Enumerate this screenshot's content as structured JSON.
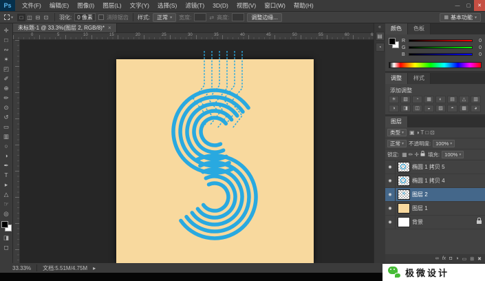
{
  "menu": {
    "logo": "Ps",
    "items": [
      "文件(F)",
      "编辑(E)",
      "图像(I)",
      "图层(L)",
      "文字(Y)",
      "选择(S)",
      "滤镜(T)",
      "3D(D)",
      "视图(V)",
      "窗口(W)",
      "帮助(H)"
    ],
    "minimize": "—",
    "restore": "▢",
    "close": "✕"
  },
  "icons": {
    "caret": "▾",
    "swap": "⇄",
    "eye": "◉",
    "scatter": "≈",
    "workspace_grid": "▦",
    "collapse": "«"
  },
  "options": {
    "selection_modes": [
      {
        "name": "new-selection-icon",
        "glyph": "□"
      },
      {
        "name": "add-selection-icon",
        "glyph": "◫"
      },
      {
        "name": "subtract-selection-icon",
        "glyph": "⊟"
      },
      {
        "name": "intersect-selection-icon",
        "glyph": "⊡"
      }
    ],
    "feather_label": "羽化:",
    "feather_value": "0 像素",
    "antialias": "消除锯齿",
    "style_label": "样式:",
    "style_value": "正常",
    "width_label": "宽度:",
    "height_label": "高度:",
    "refine_edge": "调整边缘...",
    "workspace": "基本功能"
  },
  "tab": {
    "title": "未标题-1 @ 33.3%(图层 2, RGB/8)*",
    "close": "×"
  },
  "ruler": {
    "h_numbers": [
      "0",
      "5",
      "10",
      "15",
      "20",
      "25",
      "30",
      "35",
      "40",
      "45",
      "50",
      "55",
      "60",
      "65"
    ]
  },
  "tools": [
    {
      "name": "move-tool",
      "glyph": "✛"
    },
    {
      "name": "rectangular-marquee-tool",
      "glyph": "□"
    },
    {
      "name": "lasso-tool",
      "glyph": "∾"
    },
    {
      "name": "quick-selection-tool",
      "glyph": "✶"
    },
    {
      "name": "crop-tool",
      "glyph": "◰"
    },
    {
      "name": "eyedropper-tool",
      "glyph": "✐"
    },
    {
      "name": "healing-brush-tool",
      "glyph": "⊕"
    },
    {
      "name": "brush-tool",
      "glyph": "✏"
    },
    {
      "name": "clone-stamp-tool",
      "glyph": "⊙"
    },
    {
      "name": "history-brush-tool",
      "glyph": "↺"
    },
    {
      "name": "eraser-tool",
      "glyph": "▭"
    },
    {
      "name": "gradient-tool",
      "glyph": "▥"
    },
    {
      "name": "blur-tool",
      "glyph": "○"
    },
    {
      "name": "dodge-tool",
      "glyph": "◑"
    },
    {
      "name": "pen-tool",
      "glyph": "✒"
    },
    {
      "name": "type-tool",
      "glyph": "T"
    },
    {
      "name": "path-selection-tool",
      "glyph": "▸"
    },
    {
      "name": "shape-tool",
      "glyph": "△"
    },
    {
      "name": "hand-tool",
      "glyph": "☞"
    },
    {
      "name": "zoom-tool",
      "glyph": "◎"
    }
  ],
  "extra_tools": [
    {
      "name": "quick-mask-mode-button",
      "glyph": "◨"
    },
    {
      "name": "screen-mode-button",
      "glyph": "◻"
    }
  ],
  "dock": {
    "icons": [
      {
        "name": "history-panel-icon",
        "glyph": "▤"
      },
      {
        "name": "properties-panel-icon",
        "glyph": "◔"
      }
    ]
  },
  "color_panel": {
    "tabs": [
      "颜色",
      "色板"
    ],
    "channels": [
      {
        "label": "R",
        "value": "0",
        "hex": "#ff0000"
      },
      {
        "label": "G",
        "value": "0",
        "hex": "#00ff00"
      },
      {
        "label": "B",
        "value": "0",
        "hex": "#0000ff"
      }
    ]
  },
  "adjustments_panel": {
    "tabs": [
      "调整",
      "样式"
    ],
    "title": "添加调整",
    "icons": [
      "☀",
      "▧",
      "◔",
      "▦",
      "◐",
      "▤",
      "△",
      "▥",
      "◑",
      "◨",
      "◫",
      "◒",
      "▨",
      "◓",
      "▩",
      "◕"
    ]
  },
  "layers_panel": {
    "tab": "图层",
    "filter_label": "类型",
    "filter_icons": [
      {
        "name": "filter-pixel-icon",
        "glyph": "▣"
      },
      {
        "name": "filter-adjustment-icon",
        "glyph": "◑"
      },
      {
        "name": "filter-type-icon",
        "glyph": "T"
      },
      {
        "name": "filter-shape-icon",
        "glyph": "□"
      },
      {
        "name": "filter-smart-object-icon",
        "glyph": "⊡"
      }
    ],
    "blend_mode": "正常",
    "opacity_label": "不透明度:",
    "opacity_value": "100%",
    "lock_label": "锁定:",
    "lock_icons": [
      {
        "name": "lock-transparency-icon",
        "glyph": "▦"
      },
      {
        "name": "lock-pixels-icon",
        "glyph": "✏"
      },
      {
        "name": "lock-position-icon",
        "glyph": "✛"
      }
    ],
    "fill_label": "填充:",
    "fill_value": "100%",
    "layers": [
      {
        "name": "椭圆 1 拷贝 5",
        "thumb": "ellipse",
        "selected": false,
        "locked": false
      },
      {
        "name": "椭圆 1 拷贝 4",
        "thumb": "ellipse",
        "selected": false,
        "locked": false
      },
      {
        "name": "图层 2",
        "thumb": "scatter",
        "selected": true,
        "locked": false
      },
      {
        "name": "图层 1",
        "thumb": "solid",
        "selected": false,
        "locked": false
      },
      {
        "name": "背景",
        "thumb": "white",
        "selected": false,
        "locked": true
      }
    ],
    "footer_icons": [
      {
        "name": "link-layers-icon",
        "glyph": "∞"
      },
      {
        "name": "layer-style-icon",
        "glyph": "fx"
      },
      {
        "name": "layer-mask-icon",
        "glyph": "◘"
      },
      {
        "name": "adjustment-layer-icon",
        "glyph": "◑"
      },
      {
        "name": "new-group-icon",
        "glyph": "▭"
      },
      {
        "name": "new-layer-icon",
        "glyph": "⊞"
      },
      {
        "name": "delete-layer-icon",
        "glyph": "✖"
      }
    ]
  },
  "status": {
    "zoom": "33.33%",
    "doc": "文档:5.51M/4.75M",
    "arrow": "▸"
  },
  "watermark": {
    "text": "极微设计"
  },
  "artwork": {
    "artboard_color": "#F8D99E",
    "stroke_color": "#29A9E0"
  }
}
